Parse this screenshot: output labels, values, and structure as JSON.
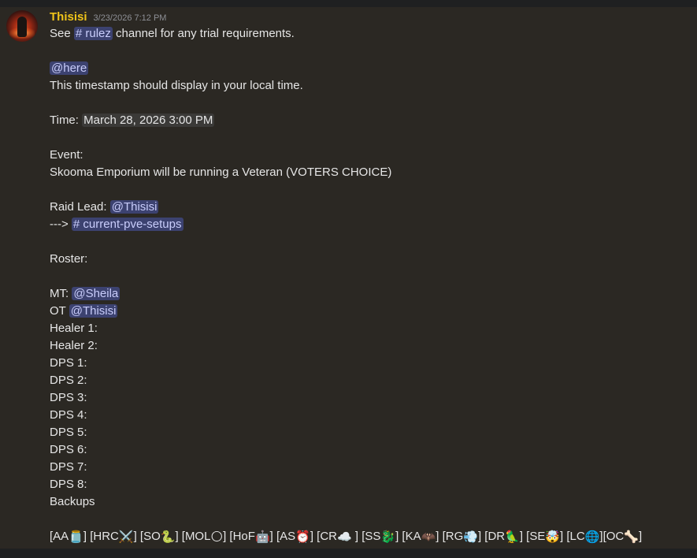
{
  "message": {
    "author": "Thisisi",
    "timestamp": "3/23/2026 7:12 PM",
    "l1_pre": "See ",
    "l1_channel": "# rulez",
    "l1_post": " channel for any trial requirements.",
    "here": "@here",
    "local_note": "This timestamp should display in your local time.",
    "time_label": "Time: ",
    "time_value": "March 28, 2026 3:00 PM",
    "event_label": "Event:",
    "event_text": "Skooma Emporium will be running a Veteran (VOTERS CHOICE)",
    "lead_label": "Raid Lead: ",
    "lead_mention": "@Thisisi",
    "arrow": "---> ",
    "setups_channel": "# current-pve-setups",
    "roster_label": "Roster:",
    "mt_label": "MT:  ",
    "mt_mention": "@Sheila",
    "ot_label": "OT  ",
    "ot_mention": "@Thisisi",
    "healer1": "Healer 1:",
    "healer2": "Healer 2:",
    "dps1": "DPS  1:",
    "dps2": "DPS 2:",
    "dps3": "DPS 3:",
    "dps4": "DPS 4:",
    "dps5": "DPS 5:",
    "dps6": "DPS 6:",
    "dps7": "DPS 7:",
    "dps8": "DPS 8:",
    "backups": "Backups",
    "trials": {
      "aa": "[AA",
      "aa_e": "🫙",
      "hrc": "] [HRC",
      "hrc_e": "⚔️",
      "so": "] [SO",
      "so_e": "🐍",
      "mol": "] [MOL",
      "mol_e": "🌕",
      "hof": "] [HoF",
      "hof_e": "🤖",
      "as": "] [AS",
      "as_e": "⏰",
      "cr": "] [CR",
      "cr_e": "☁️",
      "ss": " ] [SS",
      "ss_e": "🐉",
      "ka": "] [KA",
      "ka_e": "🦇",
      "rg": "] [RG",
      "rg_e": "💨",
      "dr": "] [DR",
      "dr_e": "🦜",
      "se": "] [SE",
      "se_e": "🤯",
      "lc": "] [LC",
      "lc_e": "🌐",
      "oc": "][OC",
      "oc_e": "🦴",
      "end": "]"
    }
  },
  "colors": {
    "background": "#2b2823",
    "author": "#f0c419",
    "mention_bg": "#3c4270",
    "mention_fg": "#c9cdfb",
    "text": "#e6e6e6"
  }
}
